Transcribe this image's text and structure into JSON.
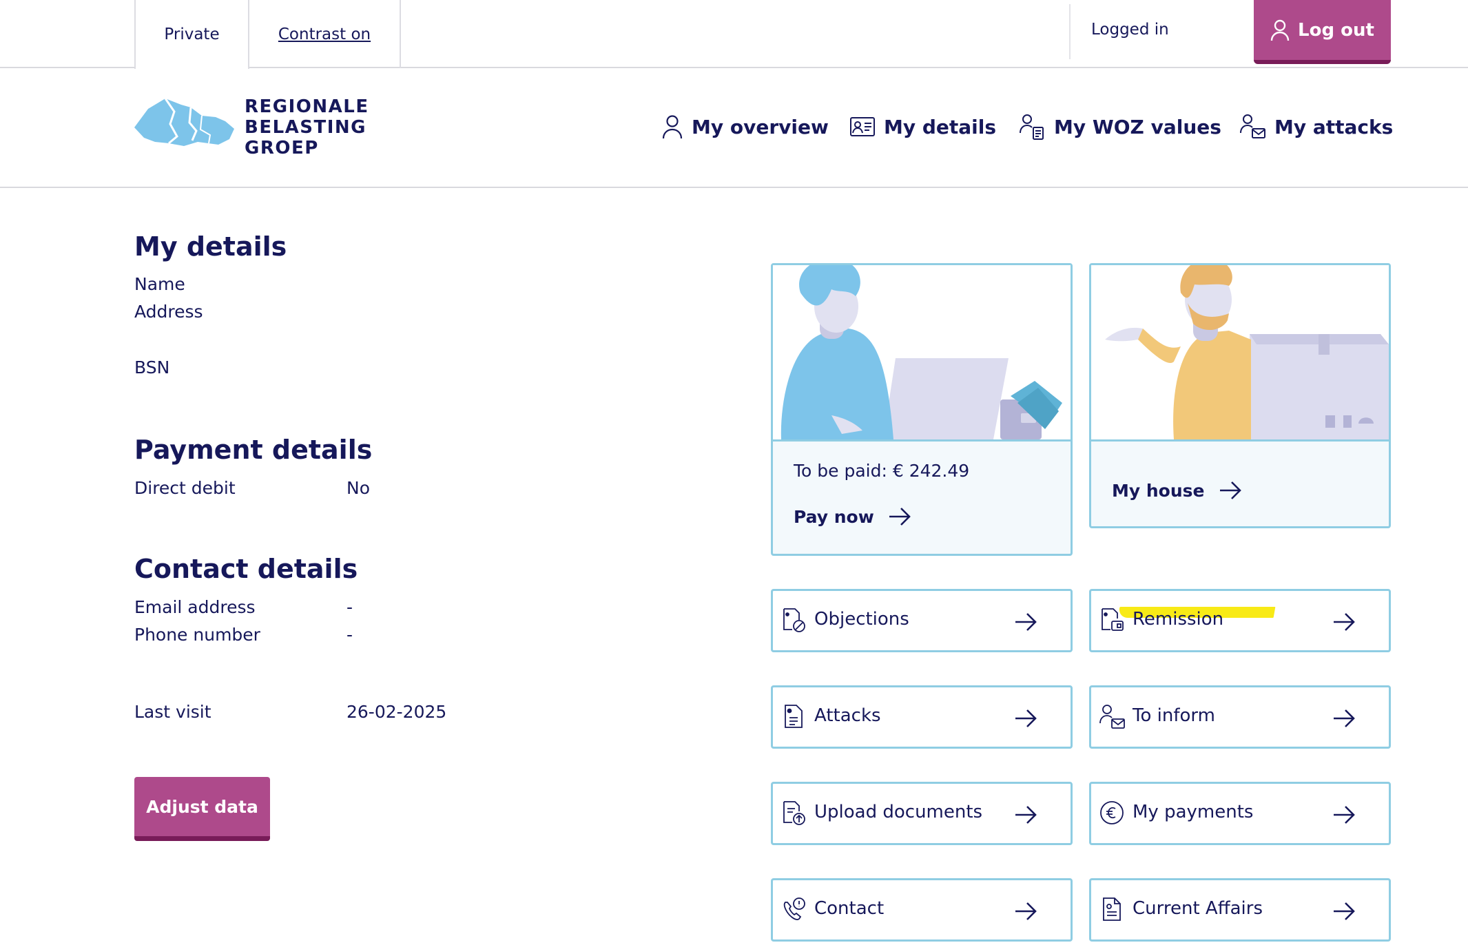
{
  "utility_bar": {
    "private_tab": "Private",
    "contrast_link": "Contrast on",
    "status": "Logged in",
    "logout_label": "Log out"
  },
  "logo": {
    "line1": "REGIONALE",
    "line2": "BELASTING",
    "line3": "GROEP"
  },
  "nav": [
    {
      "label": "My overview",
      "icon": "user-icon"
    },
    {
      "label": "My details",
      "icon": "id-card-icon"
    },
    {
      "label": "My WOZ values",
      "icon": "user-document-icon"
    },
    {
      "label": "My attacks",
      "icon": "user-mail-icon"
    }
  ],
  "details": {
    "title": "My details",
    "name_label": "Name",
    "address_label": "Address",
    "bsn_label": "BSN"
  },
  "payment": {
    "title": "Payment details",
    "direct_debit_label": "Direct debit",
    "direct_debit_value": "No"
  },
  "contact": {
    "title": "Contact details",
    "email_label": "Email address",
    "email_value": "-",
    "phone_label": "Phone number",
    "phone_value": "-"
  },
  "last_visit": {
    "label": "Last visit",
    "value": "26-02-2025"
  },
  "adjust_button": "Adjust data",
  "cards": {
    "pay": {
      "amount_text": "To be paid: € 242.49",
      "link": "Pay now"
    },
    "house": {
      "link": "My house"
    }
  },
  "tiles": [
    {
      "label": "Objections",
      "icon": "document-cancel-icon"
    },
    {
      "label": "Remission",
      "icon": "document-wallet-icon"
    },
    {
      "label": "Attacks",
      "icon": "document-list-icon"
    },
    {
      "label": "To inform",
      "icon": "user-mail-icon"
    },
    {
      "label": "Upload documents",
      "icon": "document-upload-icon"
    },
    {
      "label": "My payments",
      "icon": "euro-coin-icon"
    },
    {
      "label": "Contact",
      "icon": "phone-alert-icon"
    },
    {
      "label": "Current Affairs",
      "icon": "newspaper-icon"
    }
  ],
  "colors": {
    "navy": "#16185a",
    "magenta": "#ae4a8b",
    "magenta_dark": "#781c58",
    "card_border": "#8fcde3",
    "card_bg": "#f3f9fc",
    "highlight": "#f8ea16"
  }
}
